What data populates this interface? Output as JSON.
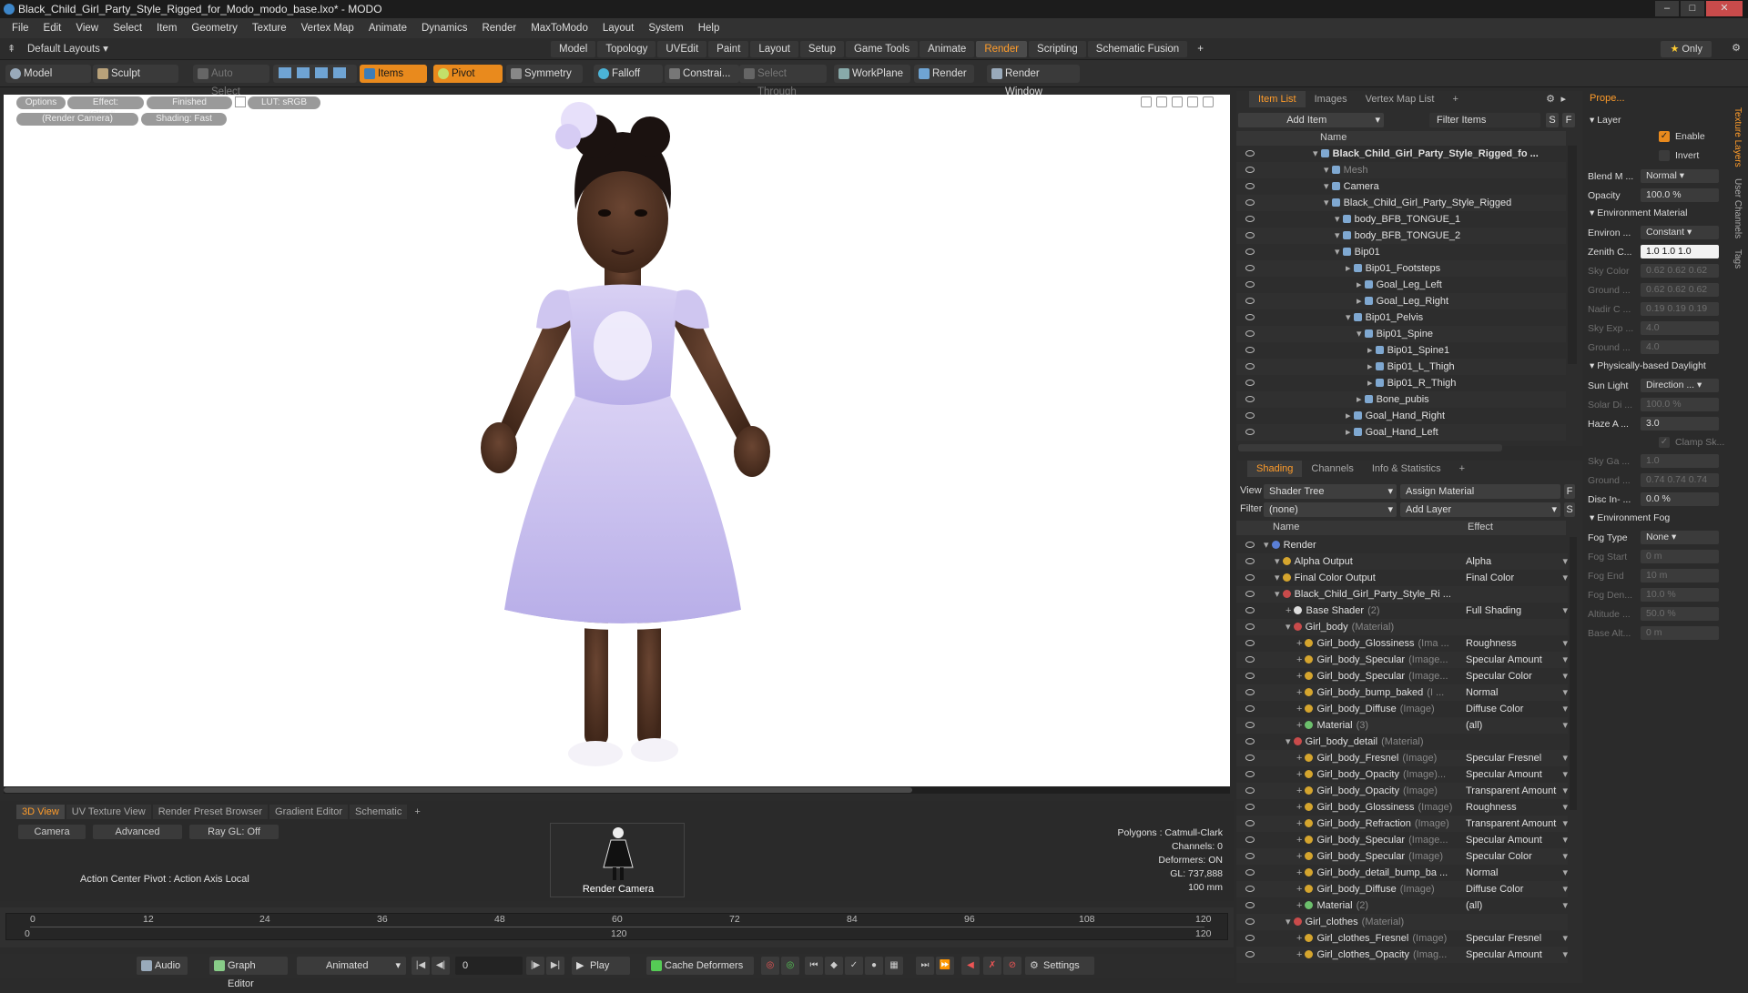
{
  "window": {
    "title": "Black_Child_Girl_Party_Style_Rigged_for_Modo_modo_base.lxo* - MODO"
  },
  "menu": [
    "File",
    "Edit",
    "View",
    "Select",
    "Item",
    "Geometry",
    "Texture",
    "Vertex Map",
    "Animate",
    "Dynamics",
    "Render",
    "MaxToModo",
    "Layout",
    "System",
    "Help"
  ],
  "layout": {
    "name": "Default Layouts",
    "tabs": [
      "Model",
      "Topology",
      "UVEdit",
      "Paint",
      "Layout",
      "Setup",
      "Game Tools",
      "Animate",
      "Render",
      "Scripting",
      "Schematic Fusion"
    ],
    "active": "Render",
    "only": "Only"
  },
  "toolbar": {
    "model": "Model",
    "sculpt": "Sculpt",
    "auto_select": "Auto Select",
    "items": "Items",
    "pivot": "Pivot",
    "symmetry": "Symmetry",
    "falloff": "Falloff",
    "constrain": "Constrai...",
    "select_through": "Select Through",
    "workplane": "WorkPlane",
    "render": "Render",
    "render_window": "Render Window"
  },
  "viewport": {
    "options": "Options",
    "effect": "Effect: (Shadi...",
    "finished": "Finished",
    "lut": "LUT: sRGB",
    "camera": "(Render Camera)",
    "shading": "Shading: Fast"
  },
  "bottom": {
    "tabs": [
      "3D View",
      "UV Texture View",
      "Render Preset Browser",
      "Gradient Editor",
      "Schematic"
    ],
    "camera_btn": "Camera",
    "advanced_btn": "Advanced",
    "raygl_btn": "Ray GL: Off",
    "action_center": "Action Center Pivot : Action Axis Local",
    "thumb_label": "Render Camera",
    "stats": [
      "Polygons : Catmull-Clark",
      "Channels: 0",
      "Deformers: ON",
      "GL: 737,888",
      "100 mm"
    ]
  },
  "timeline": {
    "ticks": [
      "0",
      "12",
      "24",
      "36",
      "48",
      "60",
      "72",
      "84",
      "96",
      "108",
      "120"
    ],
    "lower": [
      "0",
      "120",
      "120"
    ]
  },
  "transport": {
    "audio": "Audio",
    "graph_editor": "Graph Editor",
    "animated": "Animated",
    "frame": "0",
    "play": "Play",
    "cache": "Cache Deformers",
    "settings": "Settings"
  },
  "item_list": {
    "tabs": [
      "Item List",
      "Images",
      "Vertex Map List"
    ],
    "add_item": "Add Item",
    "filter_items": "Filter Items",
    "col_name": "Name",
    "rows": [
      {
        "label": "Black_Child_Girl_Party_Style_Rigged_fo ...",
        "indent": 0,
        "bold": true
      },
      {
        "label": "Mesh",
        "indent": 1,
        "gray": true
      },
      {
        "label": "Camera",
        "indent": 1
      },
      {
        "label": "Black_Child_Girl_Party_Style_Rigged",
        "indent": 1
      },
      {
        "label": "body_BFB_TONGUE_1",
        "indent": 2
      },
      {
        "label": "body_BFB_TONGUE_2",
        "indent": 2
      },
      {
        "label": "Bip01",
        "indent": 2
      },
      {
        "label": "Bip01_Footsteps",
        "indent": 3
      },
      {
        "label": "Goal_Leg_Left",
        "indent": 4
      },
      {
        "label": "Goal_Leg_Right",
        "indent": 4
      },
      {
        "label": "Bip01_Pelvis",
        "indent": 3
      },
      {
        "label": "Bip01_Spine",
        "indent": 4
      },
      {
        "label": "Bip01_Spine1",
        "indent": 5
      },
      {
        "label": "Bip01_L_Thigh",
        "indent": 5
      },
      {
        "label": "Bip01_R_Thigh",
        "indent": 5
      },
      {
        "label": "Bone_pubis",
        "indent": 4
      },
      {
        "label": "Goal_Hand_Right",
        "indent": 3
      },
      {
        "label": "Goal_Hand_Left",
        "indent": 3
      }
    ]
  },
  "shading": {
    "tabs": [
      "Shading",
      "Channels",
      "Info & Statistics"
    ],
    "view_label": "View",
    "view_value": "Shader Tree",
    "assign": "Assign Material",
    "filter_label": "Filter",
    "filter_value": "(none)",
    "add_layer": "Add Layer",
    "col_name": "Name",
    "col_effect": "Effect",
    "rows": [
      {
        "label": "Render",
        "extra": "",
        "effect": "",
        "indent": 0
      },
      {
        "label": "Alpha Output",
        "extra": "",
        "effect": "Alpha",
        "indent": 1
      },
      {
        "label": "Final Color Output",
        "extra": "",
        "effect": "Final Color",
        "indent": 1
      },
      {
        "label": "Black_Child_Girl_Party_Style_Ri ...",
        "extra": "",
        "effect": "",
        "indent": 1
      },
      {
        "label": "Base Shader",
        "extra": "(2)",
        "effect": "Full Shading",
        "indent": 2
      },
      {
        "label": "Girl_body",
        "extra": "(Material)",
        "effect": "",
        "indent": 2
      },
      {
        "label": "Girl_body_Glossiness",
        "extra": "(Ima ...",
        "effect": "Roughness",
        "indent": 3
      },
      {
        "label": "Girl_body_Specular",
        "extra": "(Image...",
        "effect": "Specular Amount",
        "indent": 3
      },
      {
        "label": "Girl_body_Specular",
        "extra": "(Image...",
        "effect": "Specular Color",
        "indent": 3
      },
      {
        "label": "Girl_body_bump_baked",
        "extra": "(I ...",
        "effect": "Normal",
        "indent": 3
      },
      {
        "label": "Girl_body_Diffuse",
        "extra": "(Image)",
        "effect": "Diffuse Color",
        "indent": 3
      },
      {
        "label": "Material",
        "extra": "(3)",
        "effect": "(all)",
        "indent": 3
      },
      {
        "label": "Girl_body_detail",
        "extra": "(Material)",
        "effect": "",
        "indent": 2
      },
      {
        "label": "Girl_body_Fresnel",
        "extra": "(Image)",
        "effect": "Specular Fresnel",
        "indent": 3
      },
      {
        "label": "Girl_body_Opacity",
        "extra": "(Image)...",
        "effect": "Specular Amount",
        "indent": 3
      },
      {
        "label": "Girl_body_Opacity",
        "extra": "(Image)",
        "effect": "Transparent Amount",
        "indent": 3
      },
      {
        "label": "Girl_body_Glossiness",
        "extra": "(Image)",
        "effect": "Roughness",
        "indent": 3
      },
      {
        "label": "Girl_body_Refraction",
        "extra": "(Image)",
        "effect": "Transparent Amount",
        "indent": 3
      },
      {
        "label": "Girl_body_Specular",
        "extra": "(Image...",
        "effect": "Specular Amount",
        "indent": 3
      },
      {
        "label": "Girl_body_Specular",
        "extra": "(Image)",
        "effect": "Specular Color",
        "indent": 3
      },
      {
        "label": "Girl_body_detail_bump_ba ...",
        "extra": "",
        "effect": "Normal",
        "indent": 3
      },
      {
        "label": "Girl_body_Diffuse",
        "extra": "(Image)",
        "effect": "Diffuse Color",
        "indent": 3
      },
      {
        "label": "Material",
        "extra": "(2)",
        "effect": "(all)",
        "indent": 3
      },
      {
        "label": "Girl_clothes",
        "extra": "(Material)",
        "effect": "",
        "indent": 2
      },
      {
        "label": "Girl_clothes_Fresnel",
        "extra": "(Image)",
        "effect": "Specular Fresnel",
        "indent": 3
      },
      {
        "label": "Girl_clothes_Opacity",
        "extra": "(Imag...",
        "effect": "Specular Amount",
        "indent": 3
      }
    ]
  },
  "properties": {
    "tab": "Prope...",
    "layer": "Layer",
    "enable": "Enable",
    "invert": "Invert",
    "blend_label": "Blend M ...",
    "blend": "Normal",
    "opacity_label": "Opacity",
    "opacity": "100.0 %",
    "env_material": "Environment Material",
    "environ_label": "Environ ...",
    "environ": "Constant",
    "zenith_label": "Zenith C...",
    "zenith": "1.0 1.0 1.0",
    "sky_label": "Sky Color",
    "sky": "0.62 0.62 0.62",
    "ground_label": "Ground ...",
    "ground": "0.62 0.62 0.62",
    "nadir_label": "Nadir C ...",
    "nadir": "0.19 0.19 0.19",
    "skyexp_label": "Sky Exp ...",
    "skyexp": "4.0",
    "groundexp_label": "Ground ...",
    "groundexp": "4.0",
    "daylight": "Physically-based Daylight",
    "sun_label": "Sun Light",
    "sun": "Direction ...",
    "solar_label": "Solar Di ...",
    "solar": "100.0 %",
    "haze_label": "Haze A ...",
    "haze": "3.0",
    "clamp": "Clamp Sk...",
    "skyga_label": "Sky Ga ...",
    "skyga": "1.0",
    "groundalb_label": "Ground ...",
    "groundalb": "0.74 0.74 0.74",
    "disc_label": "Disc In- ...",
    "disc": "0.0 %",
    "fog": "Environment Fog",
    "fogtype_label": "Fog Type",
    "fogtype": "None",
    "fogstart_label": "Fog Start",
    "fogstart": "0 m",
    "fogend_label": "Fog End",
    "fogend": "10 m",
    "fogden_label": "Fog Den...",
    "fogden": "10.0 %",
    "alt_label": "Altitude ...",
    "alt": "50.0 %",
    "basealt_label": "Base Alt...",
    "basealt": "0 m",
    "side_tabs": [
      "Texture Layers",
      "User Channels",
      "Tags"
    ]
  }
}
